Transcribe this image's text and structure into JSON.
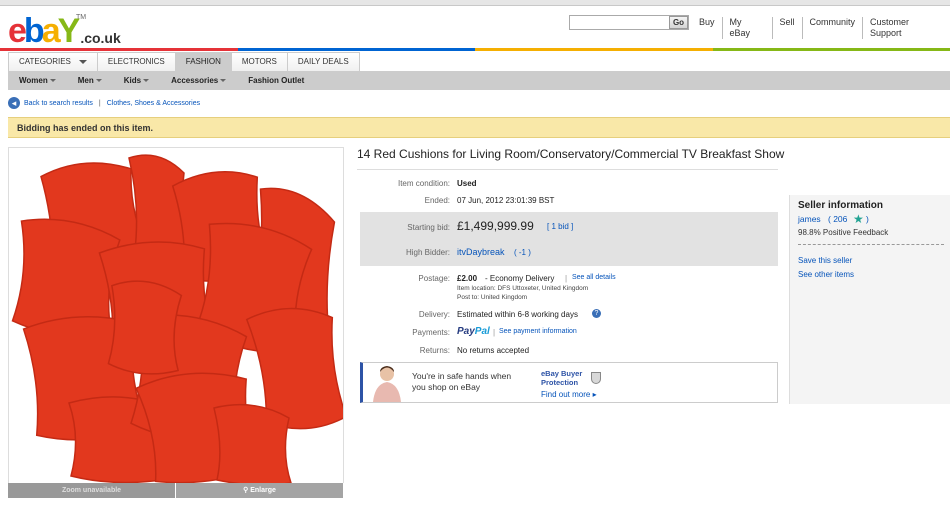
{
  "header": {
    "logo_letters": [
      "e",
      "b",
      "a",
      "Y"
    ],
    "logo_domain": ".co.uk",
    "logo_tm": "TM",
    "search_button": "Go",
    "links": [
      "Buy",
      "My eBay",
      "Sell",
      "Community",
      "Customer Support"
    ]
  },
  "nav": {
    "tabs": [
      "CATEGORIES",
      "ELECTRONICS",
      "FASHION",
      "MOTORS",
      "DAILY DEALS"
    ],
    "active_tab": "FASHION",
    "subnav": [
      "Women",
      "Men",
      "Kids",
      "Accessories",
      "Fashion Outlet"
    ]
  },
  "breadcrumb": {
    "back_label": "Back to search results",
    "category": "Clothes, Shoes & Accessories"
  },
  "notice": "Bidding has ended on this item.",
  "gallery": {
    "zoom_label": "Zoom unavailable",
    "enlarge_label": "Enlarge"
  },
  "item": {
    "title": "14 Red Cushions for Living Room/Conservatory/Commercial TV Breakfast Show",
    "condition_label": "Item condition:",
    "condition": "Used",
    "ended_label": "Ended:",
    "ended": "07 Jun, 2012 23:01:39 BST",
    "starting_bid_label": "Starting bid:",
    "starting_bid": "£1,499,999.99",
    "bids": "[ 1 bid ]",
    "high_bidder_label": "High Bidder:",
    "high_bidder": "itvDaybreak",
    "high_bidder_score": "( -1 )",
    "postage_label": "Postage:",
    "postage_price": "£2.00",
    "postage_service": "- Economy Delivery",
    "postage_link": "See all details",
    "item_location": "Item location: DFS Uttoxeter, United Kingdom",
    "post_to": "Post to: United Kingdom",
    "delivery_label": "Delivery:",
    "delivery": "Estimated within 6-8 working days",
    "payments_label": "Payments:",
    "payments_link": "See payment information",
    "returns_label": "Returns:",
    "returns": "No returns accepted"
  },
  "protection": {
    "line1": "You're in safe hands when",
    "line2": "you shop on eBay",
    "badge_line1": "eBay Buyer",
    "badge_line2": "Protection",
    "link": "Find out more ▸"
  },
  "seller": {
    "heading": "Seller information",
    "name": "james",
    "score": "( 206",
    "score_close": ")",
    "feedback": "98.8% Positive Feedback",
    "save": "Save this seller",
    "other": "See other items"
  },
  "colors": {
    "ebay_red": "#e53238",
    "ebay_blue": "#0064d2",
    "ebay_yellow": "#f5af02",
    "ebay_green": "#86b817",
    "cushion_red": "#e2381e",
    "link_blue": "#0654ba",
    "notice_bg": "#f9e8a8"
  }
}
